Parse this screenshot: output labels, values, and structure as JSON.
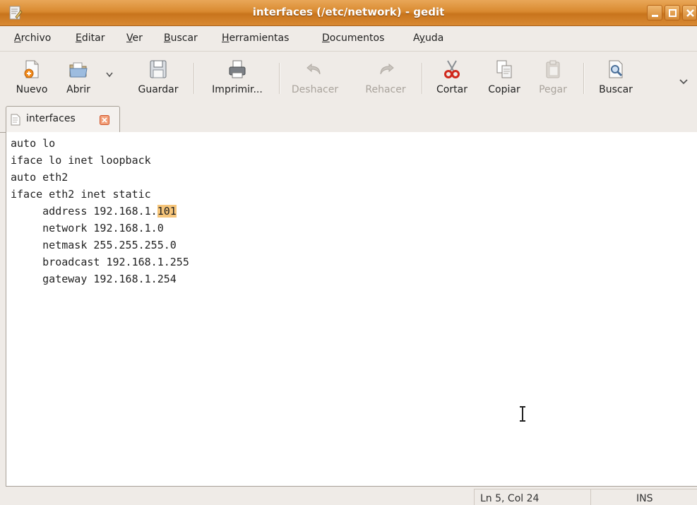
{
  "window": {
    "title": "interfaces (/etc/network) - gedit",
    "accent": "#d98a30"
  },
  "menu": {
    "items": [
      {
        "label": "Archivo",
        "mnemonic": "A",
        "rest": "rchivo"
      },
      {
        "label": "Editar",
        "mnemonic": "E",
        "rest": "ditar"
      },
      {
        "label": "Ver",
        "mnemonic": "V",
        "rest": "er"
      },
      {
        "label": "Buscar",
        "mnemonic": "B",
        "rest": "uscar"
      },
      {
        "label": "Herramientas",
        "mnemonic": "H",
        "rest": "erramientas"
      },
      {
        "label": "Documentos",
        "mnemonic": "D",
        "rest": "ocumentos"
      },
      {
        "label": "Ayuda",
        "pre": "A",
        "mnemonic": "y",
        "rest": "uda"
      }
    ]
  },
  "toolbar": {
    "new_label": "Nuevo",
    "open_label": "Abrir",
    "save_label": "Guardar",
    "print_label": "Imprimir...",
    "undo_label": "Deshacer",
    "redo_label": "Rehacer",
    "cut_label": "Cortar",
    "copy_label": "Copiar",
    "paste_label": "Pegar",
    "find_label": "Buscar",
    "disabled": [
      "Deshacer",
      "Rehacer",
      "Pegar"
    ]
  },
  "tabs": [
    {
      "label": "interfaces",
      "icon": "text-file-icon"
    }
  ],
  "editor": {
    "lines": [
      "auto lo",
      "iface lo inet loopback",
      "auto eth2",
      "iface eth2 inet static",
      "     address 192.168.1.",
      "     network 192.168.1.0",
      "     netmask 255.255.255.0",
      "     broadcast 192.168.1.255",
      "     gateway 192.168.1.254"
    ],
    "selection": "101",
    "selection_color": "#f6c57a"
  },
  "status": {
    "position": "Ln 5, Col 24",
    "mode": "INS"
  }
}
